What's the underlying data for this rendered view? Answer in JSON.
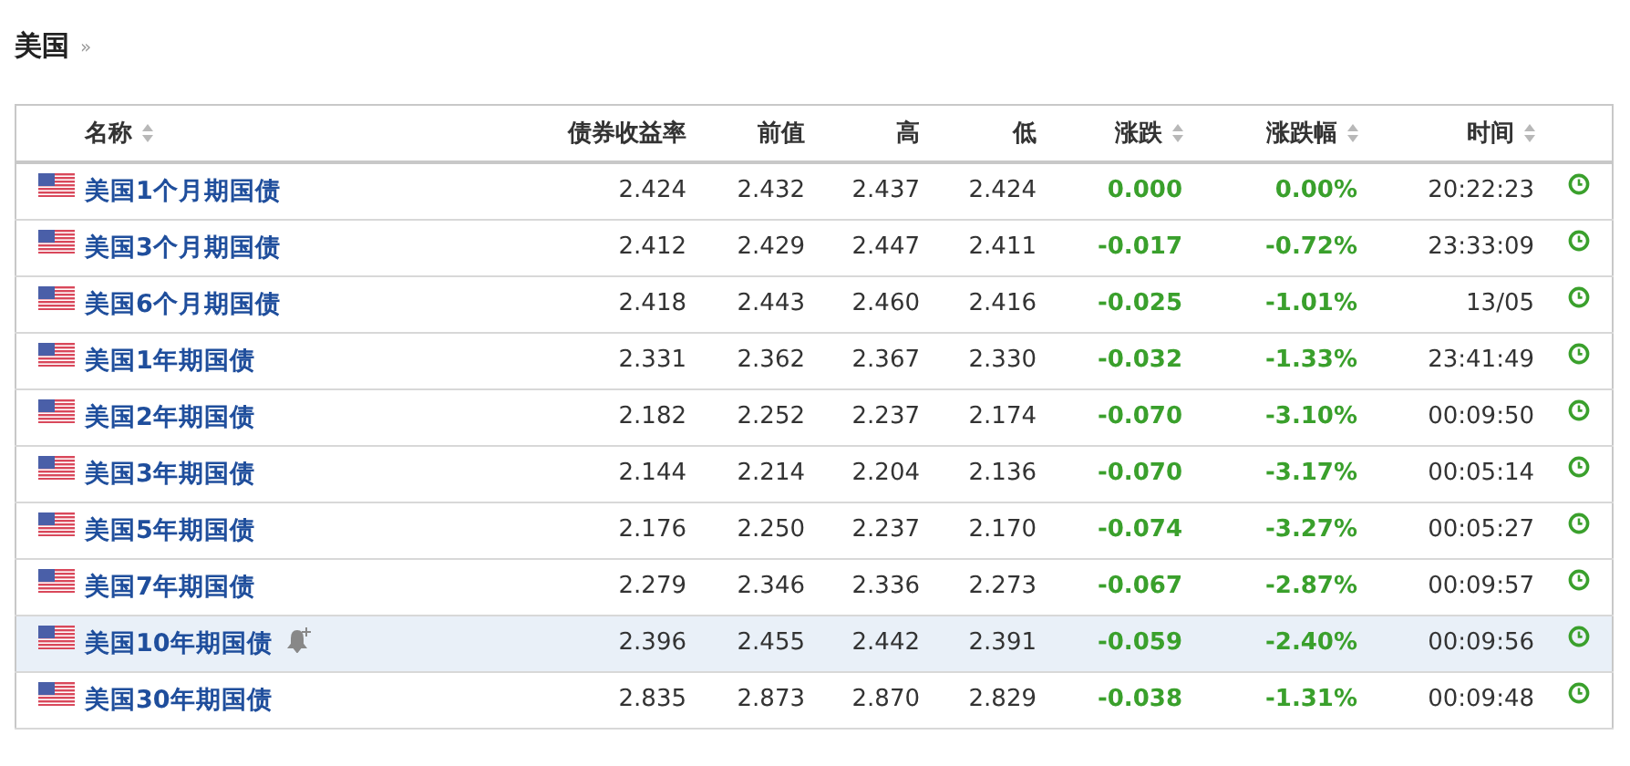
{
  "section": {
    "title": "美国",
    "more": "»"
  },
  "columns": [
    {
      "label": "名称",
      "sortable": true
    },
    {
      "label": "债券收益率",
      "sortable": false
    },
    {
      "label": "前值",
      "sortable": false
    },
    {
      "label": "高",
      "sortable": false
    },
    {
      "label": "低",
      "sortable": false
    },
    {
      "label": "涨跌",
      "sortable": true
    },
    {
      "label": "涨跌幅",
      "sortable": true
    },
    {
      "label": "时间",
      "sortable": true
    }
  ],
  "rows": [
    {
      "name": "美国1个月期国债",
      "yield": "2.424",
      "prev": "2.432",
      "high": "2.437",
      "low": "2.424",
      "change": "0.000",
      "change_pct": "0.00%",
      "time": "20:22:23",
      "hovered": false
    },
    {
      "name": "美国3个月期国债",
      "yield": "2.412",
      "prev": "2.429",
      "high": "2.447",
      "low": "2.411",
      "change": "-0.017",
      "change_pct": "-0.72%",
      "time": "23:33:09",
      "hovered": false
    },
    {
      "name": "美国6个月期国债",
      "yield": "2.418",
      "prev": "2.443",
      "high": "2.460",
      "low": "2.416",
      "change": "-0.025",
      "change_pct": "-1.01%",
      "time": "13/05",
      "hovered": false
    },
    {
      "name": "美国1年期国债",
      "yield": "2.331",
      "prev": "2.362",
      "high": "2.367",
      "low": "2.330",
      "change": "-0.032",
      "change_pct": "-1.33%",
      "time": "23:41:49",
      "hovered": false
    },
    {
      "name": "美国2年期国债",
      "yield": "2.182",
      "prev": "2.252",
      "high": "2.237",
      "low": "2.174",
      "change": "-0.070",
      "change_pct": "-3.10%",
      "time": "00:09:50",
      "hovered": false
    },
    {
      "name": "美国3年期国债",
      "yield": "2.144",
      "prev": "2.214",
      "high": "2.204",
      "low": "2.136",
      "change": "-0.070",
      "change_pct": "-3.17%",
      "time": "00:05:14",
      "hovered": false
    },
    {
      "name": "美国5年期国债",
      "yield": "2.176",
      "prev": "2.250",
      "high": "2.237",
      "low": "2.170",
      "change": "-0.074",
      "change_pct": "-3.27%",
      "time": "00:05:27",
      "hovered": false
    },
    {
      "name": "美国7年期国债",
      "yield": "2.279",
      "prev": "2.346",
      "high": "2.336",
      "low": "2.273",
      "change": "-0.067",
      "change_pct": "-2.87%",
      "time": "00:09:57",
      "hovered": false
    },
    {
      "name": "美国10年期国债",
      "yield": "2.396",
      "prev": "2.455",
      "high": "2.442",
      "low": "2.391",
      "change": "-0.059",
      "change_pct": "-2.40%",
      "time": "00:09:56",
      "hovered": true
    },
    {
      "name": "美国30年期国债",
      "yield": "2.835",
      "prev": "2.873",
      "high": "2.870",
      "low": "2.829",
      "change": "-0.038",
      "change_pct": "-1.31%",
      "time": "00:09:48",
      "hovered": false
    }
  ]
}
